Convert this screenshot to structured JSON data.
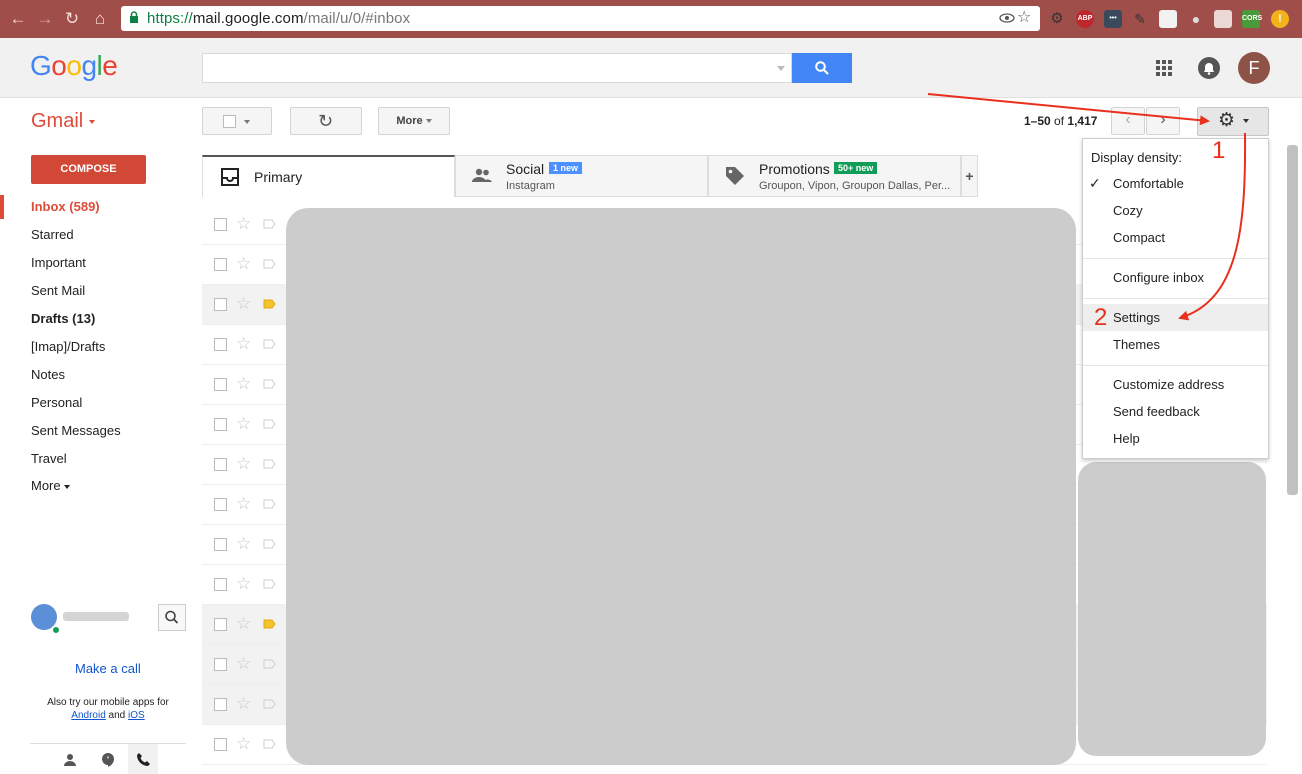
{
  "browser": {
    "url_secure": "https://",
    "url_domain": "mail.google.com",
    "url_path": "/mail/u/0/#inbox"
  },
  "header": {
    "logo": "Google",
    "avatar_letter": "F"
  },
  "toolbar": {
    "gmail_label": "Gmail",
    "more_label": "More",
    "pagination_range": "1–50",
    "pagination_of": "of",
    "pagination_total": "1,417"
  },
  "sidebar": {
    "compose_label": "COMPOSE",
    "items": [
      {
        "label": "Inbox (589)",
        "bold": true
      },
      {
        "label": "Starred"
      },
      {
        "label": "Important"
      },
      {
        "label": "Sent Mail"
      },
      {
        "label": "Drafts (13)",
        "bold": true
      },
      {
        "label": "[Imap]/Drafts"
      },
      {
        "label": "Notes"
      },
      {
        "label": "Personal"
      },
      {
        "label": "Sent Messages"
      },
      {
        "label": "Travel"
      },
      {
        "label": "More"
      }
    ],
    "make_call": "Make a call",
    "mobile_note_prefix": "Also try our mobile apps for",
    "android": "Android",
    "and": "and",
    "ios": "iOS"
  },
  "tabs": [
    {
      "label": "Primary"
    },
    {
      "label": "Social",
      "badge": "1 new",
      "sub": "Instagram"
    },
    {
      "label": "Promotions",
      "badge": "50+ new",
      "sub": "Groupon, Vipon, Groupon Dallas, Per..."
    }
  ],
  "settings_menu": {
    "heading": "Display density:",
    "items": [
      "Comfortable",
      "Cozy",
      "Compact",
      "Configure inbox",
      "Settings",
      "Themes",
      "Customize address",
      "Send feedback",
      "Help"
    ]
  },
  "annotations": {
    "step1": "1",
    "step2": "2"
  },
  "colors": {
    "chrome_bar": "#a04e4a",
    "gmail_red": "#dd4b39",
    "compose_red": "#d14836",
    "search_blue": "#4285f4",
    "annotation_red": "#e8301c",
    "social_badge": "#4d90fe",
    "promo_badge": "#0f9d58"
  }
}
